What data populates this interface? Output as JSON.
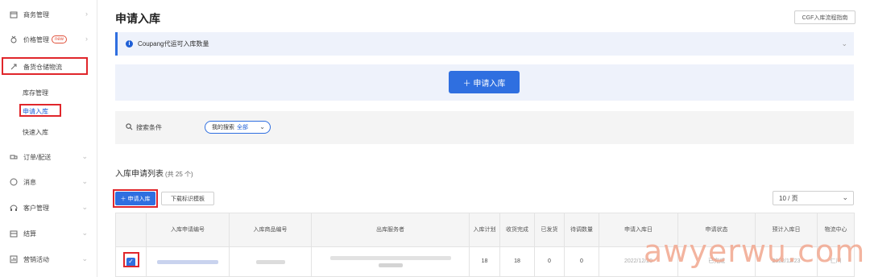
{
  "sidebar": {
    "items": [
      {
        "label": "商务管理",
        "icon": "calendar-icon"
      },
      {
        "label": "价格管理",
        "icon": "medal-icon",
        "badge": "new"
      },
      {
        "label": "备货仓储物流",
        "icon": "rocket-icon"
      },
      {
        "label": "订单/配送",
        "icon": "truck-icon"
      },
      {
        "label": "消息",
        "icon": "chat-icon"
      },
      {
        "label": "客户管理",
        "icon": "headset-icon"
      },
      {
        "label": "结算",
        "icon": "wallet-icon"
      },
      {
        "label": "营销活动",
        "icon": "chart-icon"
      }
    ],
    "sub_items": [
      {
        "label": "库存管理"
      },
      {
        "label": "申请入库"
      },
      {
        "label": "快速入库"
      }
    ]
  },
  "header": {
    "title": "申请入库",
    "guide_label": "CGF入库流程指南"
  },
  "notice": {
    "text": "Coupang代运可入库数量"
  },
  "apply": {
    "button_label": "＋ 申请入库"
  },
  "filter": {
    "label": "搜索条件",
    "chip_label": "我的搜索",
    "chip_value": "全部"
  },
  "list": {
    "title": "入库申请列表",
    "count": "(共 25 个)",
    "new_button": "＋ 申请入库",
    "template_button": "下载标识模板",
    "page_size": "10 / 页"
  },
  "table": {
    "columns": [
      "入库申请编号",
      "入库商品编号",
      "出库服务者",
      "入库计划",
      "收货完成",
      "已发货",
      "待调数量",
      "申请入库日",
      "申请状态",
      "预计入库日",
      "物流中心"
    ],
    "row": {
      "checked": true,
      "planned": "18",
      "received": "18",
      "shipped": "0",
      "pending": "0",
      "apply_date": "2022/12/20",
      "status": "已完成",
      "expected_date": "2022/12/23",
      "center": "仁川"
    }
  },
  "watermark": "awyerwu.com",
  "colors": {
    "accent": "#2f6fe0",
    "highlight": "#e0262b",
    "panel": "#eef2fb"
  }
}
